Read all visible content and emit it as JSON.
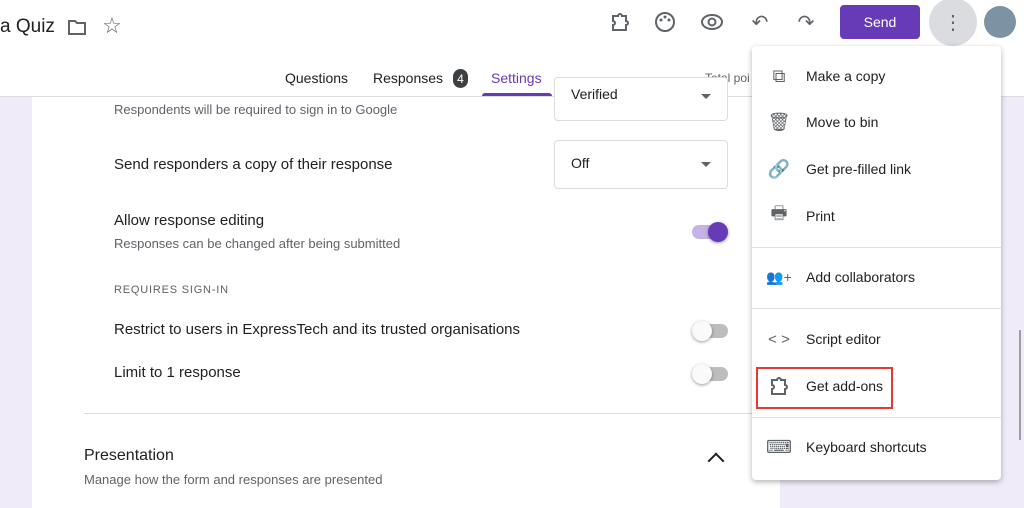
{
  "header": {
    "title": "a Quiz",
    "send_label": "Send",
    "icons": [
      "folder-icon",
      "star-icon",
      "addon-icon",
      "palette-icon",
      "preview-icon",
      "undo-icon",
      "redo-icon",
      "more-vert-icon",
      "avatar"
    ]
  },
  "tabs": [
    {
      "label": "Questions"
    },
    {
      "label": "Responses",
      "badge": "4"
    },
    {
      "label": "Settings",
      "active": true
    }
  ],
  "total_points": "Total poi",
  "settings": {
    "sign_in_desc": "Respondents will be required to sign in to Google",
    "verified_value": "Verified",
    "send_copy": {
      "label": "Send responders a copy of their response",
      "value": "Off"
    },
    "allow_editing": {
      "label": "Allow response editing",
      "desc": "Responses can be changed after being submitted",
      "on": true
    },
    "requires_sign_in": "REQUIRES SIGN-IN",
    "restrict": {
      "label": "Restrict to users in ExpressTech and its trusted organisations",
      "on": false
    },
    "limit": {
      "label": "Limit to 1 response",
      "on": false
    },
    "presentation": {
      "title": "Presentation",
      "desc": "Manage how the form and responses are presented"
    }
  },
  "menu": {
    "items": [
      {
        "label": "Make a copy",
        "icon": "copy-icon"
      },
      {
        "label": "Move to bin",
        "icon": "trash-icon"
      },
      {
        "label": "Get pre-filled link",
        "icon": "link-icon"
      },
      {
        "label": "Print",
        "icon": "print-icon"
      },
      {
        "label": "Add collaborators",
        "icon": "add-people-icon"
      },
      {
        "label": "Script editor",
        "icon": "code-icon"
      },
      {
        "label": "Get add-ons",
        "icon": "addon-icon",
        "highlighted": true
      },
      {
        "label": "Keyboard shortcuts",
        "icon": "keyboard-icon"
      }
    ]
  },
  "colors": {
    "accent": "#673ab7",
    "highlight": "#e53935",
    "background": "#f0ebf8"
  }
}
